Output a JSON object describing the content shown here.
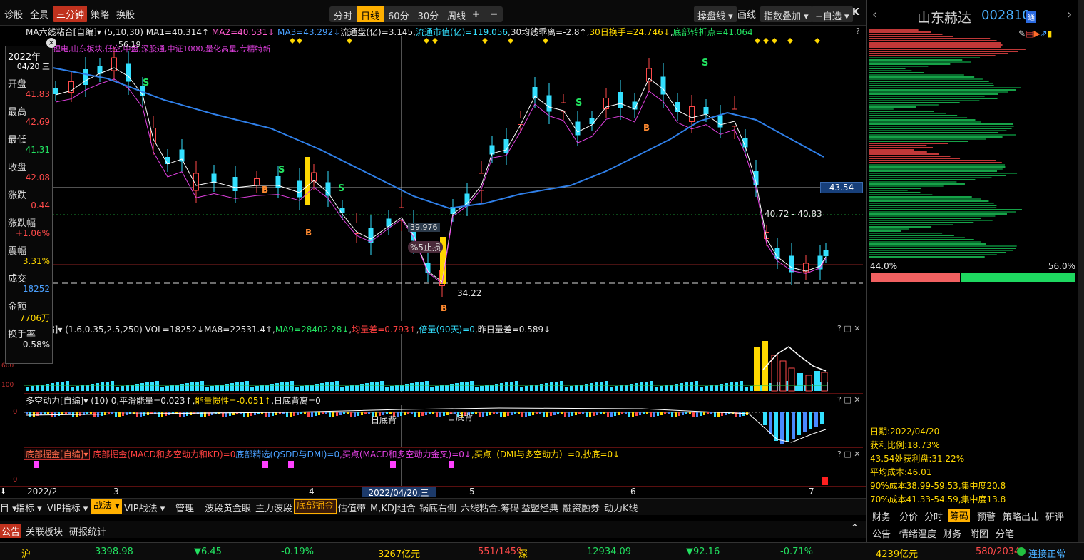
{
  "toolbar": {
    "left_items": [
      "诊股",
      "全景",
      "三分钟",
      "策略",
      "换股"
    ],
    "active_left": "三分钟",
    "periods": [
      "分时",
      "日线",
      "60分",
      "30分",
      "周线 ▾"
    ],
    "active_period": "日线",
    "plus": "+",
    "minus": "−",
    "right_buttons": [
      "操盘线 ▾",
      "画线",
      "指数叠加 ▾",
      "−自选 ▾"
    ],
    "right_arrow": "K"
  },
  "indicator_line": {
    "name": "MA六线粘合[自编]▾",
    "params": "(5,10,30)",
    "ma1": "MA1=40.314↑",
    "ma2": "MA2=40.531↓",
    "ma3": "MA3=43.292↓",
    "float_shares": "流通盘(亿)=3.145",
    "float_value": "流通市值(亿)=119.056",
    "ma30_dev": "30均线乖离=-2.8↑",
    "turnover30": "30日换手=24.746↓",
    "bottom_turn": "底部转折点=41.064"
  },
  "concept_tags": "锂电,山东板块,低空,中盘,深股通,中证1000,量化高星,专精特新",
  "price_labels": {
    "high": "56.19",
    "cursor_price": "39.976",
    "stop_loss": "%5止损",
    "low": "34.22",
    "right_price": "43.54",
    "range": "40.72 - 40.83"
  },
  "info_panel": {
    "year": "2022年",
    "date": "04/20 三",
    "rows": [
      {
        "label": "开盘",
        "value": "41.83",
        "color": "#ff4a4a"
      },
      {
        "label": "最高",
        "value": "42.69",
        "color": "#ff4a4a"
      },
      {
        "label": "最低",
        "value": "41.31",
        "color": "#22e060"
      },
      {
        "label": "收盘",
        "value": "42.08",
        "color": "#ff4a4a"
      },
      {
        "label": "涨跌",
        "value": "0.44",
        "color": "#ff4a4a"
      },
      {
        "label": "涨跌幅",
        "value": "+1.06%",
        "color": "#ff4a4a"
      },
      {
        "label": "震幅",
        "value": "3.31%",
        "color": "#ffd800"
      },
      {
        "label": "成交",
        "value": "18252",
        "color": "#4aa0ff"
      },
      {
        "label": "金额",
        "value": "7706万",
        "color": "#ffd800"
      },
      {
        "label": "换手率",
        "value": "0.58%",
        "color": "#e6e6e6"
      }
    ]
  },
  "vol_line": {
    "name": "现[自编]▾",
    "params": "(1.6,0.35,2.5,250)",
    "vol": "VOL=18252↓",
    "ma8": "MA8=22531.4↑",
    "ma9": "MA9=28402.28↓",
    "avg_diff": "均量差=0.793↑",
    "multiple": "倍量(90天)=0",
    "prev_diff": "昨日量差=0.589↓"
  },
  "vol_axis": [
    "600",
    "100"
  ],
  "dk_line": {
    "name": "多空动力[自编]▾",
    "params": "(10)",
    "body": "0,平滑能量=0.023↑,",
    "inertia": "能量惯性=-0.051↑",
    "divergence": ",日底背离=0"
  },
  "dk_axis": "0",
  "dk_marks": [
    "日底背",
    "日底背"
  ],
  "bottom_line": {
    "name": "底部掘金[自编]▾",
    "a": "底部掘金(MACD和多空动力和KD)=0",
    "b": "底部精选(QSDD与DMI)=0",
    "c": ",买点(MACD和多空动力金叉)=0↓",
    "d": ",买点（DMI与多空动力）=0",
    "e": ",抄底=0↓"
  },
  "bottom_axis": "0",
  "time_axis": {
    "labels": [
      "2022/2",
      "3",
      "4",
      "5",
      "6",
      "7"
    ],
    "cursor_date": "2022/04/20,三"
  },
  "tabs": {
    "items": [
      "目 ▾",
      "指标 ▾",
      "VIP指标 ▾",
      "战法 ▾",
      "VIP战法 ▾",
      "管理",
      "波段黄金眼",
      "主力波段",
      "底部掘金",
      "估值带",
      "M,KDJ组合",
      "锅底右侧",
      "六线粘合.筹码",
      "益盟经典",
      "融资融券",
      "动力K线"
    ]
  },
  "news_tabs": [
    "公告",
    "关联板块",
    "研报统计"
  ],
  "stock": {
    "name": "山东赫达",
    "code": "002810",
    "badge": "通",
    "pct_left": "44.0%",
    "pct_right": "56.0%"
  },
  "chip_stats": [
    {
      "text": "日期:2022/04/20"
    },
    {
      "text": "获利比例:18.73%"
    },
    {
      "text": "43.54处获利盘:31.22%"
    },
    {
      "text": "平均成本:46.01"
    },
    {
      "text": "90%成本38.99-59.53,集中度20.8"
    },
    {
      "text": "70%成本41.33-54.59,集中度13.8"
    }
  ],
  "right_tabs_row1": [
    "财务",
    "分价",
    "分时",
    "筹码",
    "预警",
    "策略出击",
    "研评"
  ],
  "right_tabs_row2": [
    "公告",
    "情绪温度",
    "财务",
    "附图",
    "分笔"
  ],
  "status": {
    "sh_name": "沪",
    "sh_index": "3398.98",
    "sh_change": "▼6.45",
    "sh_pct": "-0.19%",
    "sh_amount": "3267亿元",
    "sh_updown": "551/1459",
    "sz_name": "深",
    "sz_index": "12934.09",
    "sz_change": "▼92.16",
    "sz_pct": "-0.71%",
    "sz_amount": "4239亿元",
    "sz_updown": "580/2034",
    "connection": "连接正常"
  }
}
